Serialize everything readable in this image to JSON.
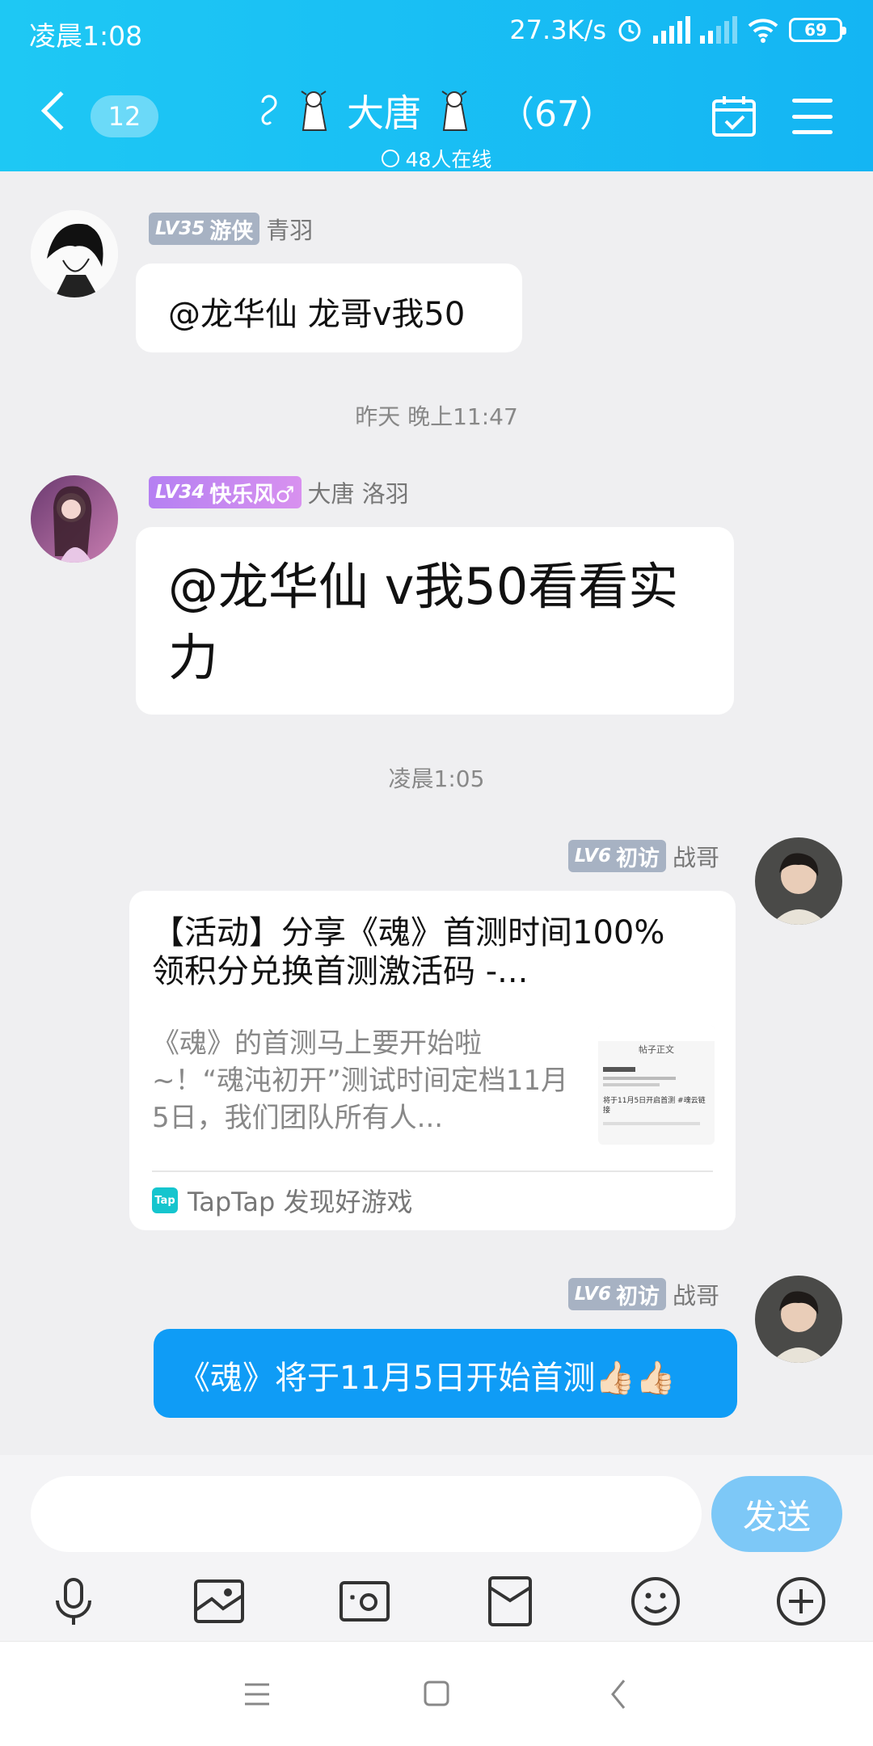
{
  "status_bar": {
    "time": "凌晨1:08",
    "speed": "27.3K/s",
    "battery": "69"
  },
  "header": {
    "back_count": "12",
    "title": "大唐",
    "member_count": "（67）",
    "online": "48人在线"
  },
  "messages": [
    {
      "level": "LV35",
      "rank": "游侠",
      "user": "青羽",
      "text": "@龙华仙 龙哥v我50"
    },
    {
      "timestamp": "昨天 晚上11:47"
    },
    {
      "level": "LV34",
      "rank": "快乐风♂",
      "user": "大唐  洛羽",
      "text": "@龙华仙 v我50看看实力"
    },
    {
      "timestamp": "凌晨1:05"
    },
    {
      "level": "LV6",
      "rank": "初访",
      "user": "战哥",
      "card": {
        "title": "【活动】分享《魂》首测时间100%领积分兑换首测激活码 -...",
        "desc": "《魂》的首测马上要开始啦~！“魂沌初开”测试时间定档11月5日，我们团队所有人...",
        "thumb_title": "帖子正文",
        "thumb_line": "将于11月5日开启首测 #魂云链接",
        "source": "TapTap 发现好游戏",
        "source_icon": "Tap"
      }
    },
    {
      "level": "LV6",
      "rank": "初访",
      "user": "战哥",
      "text": "《魂》将于11月5日开始首测👍🏻👍🏻"
    }
  ],
  "input": {
    "placeholder": "",
    "send_label": "发送"
  },
  "colors": {
    "header": "#14b5f3",
    "send": "#7dc8f7",
    "bubble_blue": "#0f9cf6"
  }
}
